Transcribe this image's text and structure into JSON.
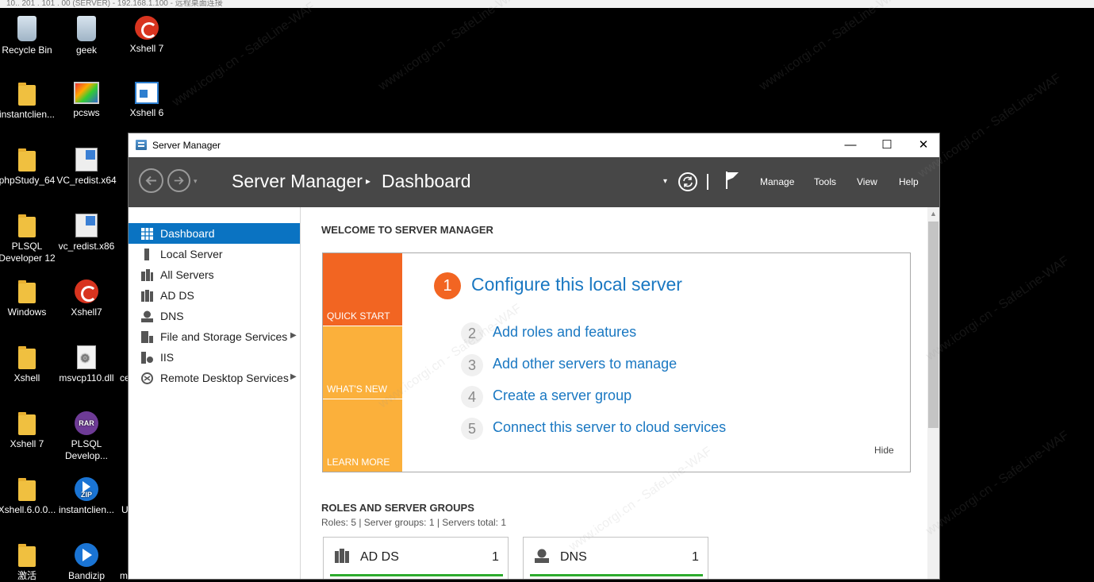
{
  "topbar": {
    "text": "10.. 201 . 101 . 00 (SERVER) - 192.168.1.100 - 远程桌面连接"
  },
  "desktop": {
    "icons": [
      {
        "label": "Recycle Bin",
        "icon": "recycle-bin-icon"
      },
      {
        "label": "geek",
        "icon": "geek-uninstaller-icon"
      },
      {
        "label": "Xshell 7",
        "icon": "xshell-icon"
      },
      {
        "label": "instantclien...",
        "icon": "folder-icon"
      },
      {
        "label": "pcsws",
        "icon": "pcsws-icon"
      },
      {
        "label": "Xshell 6",
        "icon": "xshell6-icon"
      },
      {
        "label": "phpStudy_64",
        "icon": "folder-icon"
      },
      {
        "label": "VC_redist.x64",
        "icon": "installer-icon"
      },
      {
        "label": "PLSQL Developer 12",
        "icon": "folder-icon"
      },
      {
        "label": "vc_redist.x86",
        "icon": "installer-icon"
      },
      {
        "label": "Windows",
        "icon": "folder-icon"
      },
      {
        "label": "Xshell7",
        "icon": "xshell-icon"
      },
      {
        "label": "Xshell",
        "icon": "folder-icon"
      },
      {
        "label": "msvcp110.dll",
        "icon": "dll-file-icon"
      },
      {
        "label": "Xshell 7",
        "icon": "folder-icon"
      },
      {
        "label": "PLSQL Develop...",
        "icon": "rar-archive-icon"
      },
      {
        "label": "Xshell.6.0.0...",
        "icon": "folder-icon"
      },
      {
        "label": "instantclien...",
        "icon": "zip-archive-icon"
      },
      {
        "label": "激活",
        "icon": "folder-icon"
      },
      {
        "label": "Bandizip",
        "icon": "bandizip-icon"
      }
    ],
    "partial_labels": [
      "ce",
      "U",
      "m"
    ],
    "rar_badge": "RAR",
    "zip_badge": "ZIP"
  },
  "window": {
    "title": "Server Manager",
    "minimize": "—",
    "maximize": "☐",
    "close": "✕"
  },
  "header": {
    "breadcrumb_root": "Server Manager",
    "breadcrumb_sep": "▸",
    "breadcrumb_page": "Dashboard",
    "dropdown_glyph": "▾",
    "menu": [
      "Manage",
      "Tools",
      "View",
      "Help"
    ]
  },
  "sidebar": {
    "items": [
      {
        "label": "Dashboard",
        "icon": "dashboard-grid-icon",
        "active": true
      },
      {
        "label": "Local Server",
        "icon": "server-icon"
      },
      {
        "label": "All Servers",
        "icon": "servers-icon"
      },
      {
        "label": "AD DS",
        "icon": "ad-ds-icon"
      },
      {
        "label": "DNS",
        "icon": "dns-icon"
      },
      {
        "label": "File and Storage Services",
        "icon": "file-storage-icon",
        "submenu": true
      },
      {
        "label": "IIS",
        "icon": "iis-icon"
      },
      {
        "label": "Remote Desktop Services",
        "icon": "remote-desktop-icon",
        "submenu": true
      }
    ],
    "submenu_glyph": "▶"
  },
  "main": {
    "welcome_title": "WELCOME TO SERVER MANAGER",
    "tiles": [
      "QUICK START",
      "WHAT'S NEW",
      "LEARN MORE"
    ],
    "steps": [
      {
        "num": "1",
        "label": "Configure this local server"
      },
      {
        "num": "2",
        "label": "Add roles and features"
      },
      {
        "num": "3",
        "label": "Add other servers to manage"
      },
      {
        "num": "4",
        "label": "Create a server group"
      },
      {
        "num": "5",
        "label": "Connect this server to cloud services"
      }
    ],
    "hide": "Hide",
    "roles_title": "ROLES AND SERVER GROUPS",
    "roles_summary": "Roles: 5   |   Server groups: 1   |   Servers total: 1",
    "role_cards": [
      {
        "name": "AD DS",
        "count": "1",
        "icon": "ad-ds-icon"
      },
      {
        "name": "DNS",
        "count": "1",
        "icon": "dns-icon"
      }
    ]
  },
  "watermark": "www.icorgi.cn - SafeLine-WAF",
  "colors": {
    "header_bg": "#474747",
    "sidebar_active": "#0a73c2",
    "link": "#1a78c2",
    "quick_start": "#f26522",
    "whats_new": "#fbb03b",
    "learn_more": "#fbb03b",
    "role_status_ok": "#2eab2e"
  }
}
